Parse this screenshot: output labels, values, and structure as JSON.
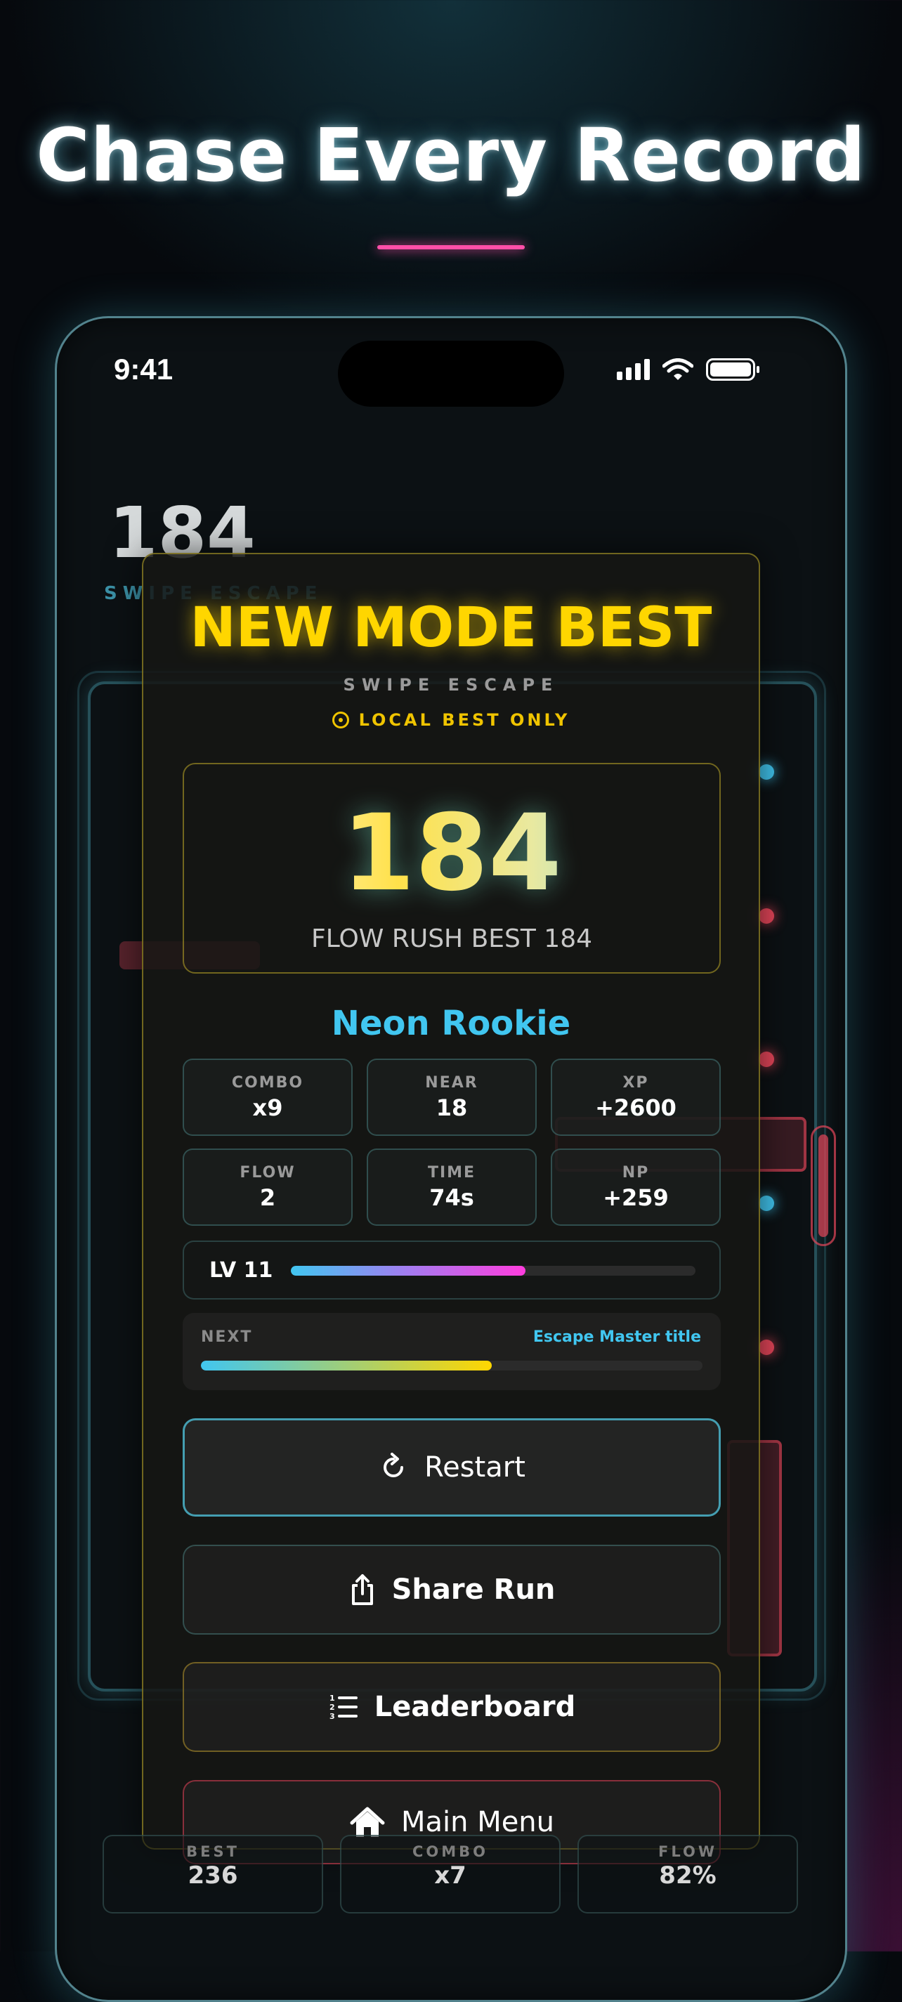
{
  "promo": {
    "headline": "Chase Every Record"
  },
  "status_bar": {
    "time": "9:41"
  },
  "game_bg": {
    "score": "184",
    "mode_label": "SWIPE ESCAPE"
  },
  "modal": {
    "title": "NEW MODE BEST",
    "mode": "SWIPE ESCAPE",
    "local_note": "LOCAL BEST ONLY",
    "score": "184",
    "flow_best": "FLOW RUSH BEST 184",
    "rank_title": "Neon Rookie",
    "stats": [
      {
        "label": "COMBO",
        "value": "x9"
      },
      {
        "label": "NEAR",
        "value": "18"
      },
      {
        "label": "XP",
        "value": "+2600"
      },
      {
        "label": "FLOW",
        "value": "2"
      },
      {
        "label": "TIME",
        "value": "74s"
      },
      {
        "label": "NP",
        "value": "+259"
      }
    ],
    "level": {
      "label": "LV 11",
      "progress": 0.58
    },
    "next": {
      "label": "NEXT",
      "target": "Escape Master title",
      "progress": 0.58
    },
    "buttons": {
      "restart": "Restart",
      "share": "Share Run",
      "leaderboard": "Leaderboard",
      "main_menu": "Main Menu"
    }
  },
  "bottom_stats": [
    {
      "label": "BEST",
      "value": "236"
    },
    {
      "label": "COMBO",
      "value": "x7"
    },
    {
      "label": "FLOW",
      "value": "82%"
    }
  ],
  "colors": {
    "accent_cyan": "#41c6f0",
    "accent_yellow": "#ffd600",
    "accent_pink": "#ff4fa8",
    "danger_red": "#e6465a"
  }
}
